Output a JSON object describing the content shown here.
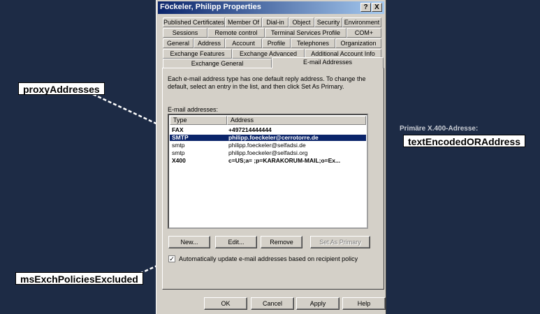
{
  "dialog": {
    "title": "Föckeler, Philipp Properties",
    "help_btn": "?",
    "close_btn": "X",
    "tab_rows": [
      [
        "Published Certificates",
        "Member Of",
        "Dial-in",
        "Object",
        "Security",
        "Environment"
      ],
      [
        "Sessions",
        "Remote control",
        "Terminal Services Profile",
        "COM+"
      ],
      [
        "General",
        "Address",
        "Account",
        "Profile",
        "Telephones",
        "Organization"
      ],
      [
        "Exchange Features",
        "Exchange Advanced",
        "Additional Account Info"
      ],
      [
        "Exchange General",
        "E-mail Addresses"
      ]
    ],
    "selected_tab": "E-mail Addresses",
    "description": "Each e-mail address type has one default reply address. To change the default, select an entry in the list, and then click Set As Primary.",
    "list_label": "E-mail addresses:",
    "columns": [
      "Type",
      "Address"
    ],
    "rows": [
      {
        "type": "FAX",
        "address": "+497214444444",
        "bold": true,
        "selected": false
      },
      {
        "type": "SMTP",
        "address": "philipp.foeckeler@cerrotorre.de",
        "bold": true,
        "selected": true
      },
      {
        "type": "smtp",
        "address": "philipp.foeckeler@selfadsi.de",
        "bold": false,
        "selected": false
      },
      {
        "type": "smtp",
        "address": "philipp.foeckeler@selfadsi.org",
        "bold": false,
        "selected": false
      },
      {
        "type": "X400",
        "address": "c=US;a= ;p=KARAKORUM-MAIL;o=Ex...",
        "bold": true,
        "selected": false
      }
    ],
    "buttons": {
      "new": "New...",
      "edit": "Edit...",
      "remove": "Remove",
      "set_primary": "Set As Primary"
    },
    "checkbox": {
      "checked": true,
      "label": "Automatically update e-mail addresses based on recipient policy"
    },
    "footer": {
      "ok": "OK",
      "cancel": "Cancel",
      "apply": "Apply",
      "help": "Help"
    }
  },
  "annotations": {
    "proxy": "proxyAddresses",
    "policies": "msExchPoliciesExcluded",
    "caption": "Primäre X.400-Adresse:",
    "text_encoded": "textEncodedORAddress"
  },
  "colors": {
    "background": "#1d2b45",
    "dialog": "#d4d0c8",
    "titlebar": "#0a246a",
    "selection": "#0a246a"
  }
}
